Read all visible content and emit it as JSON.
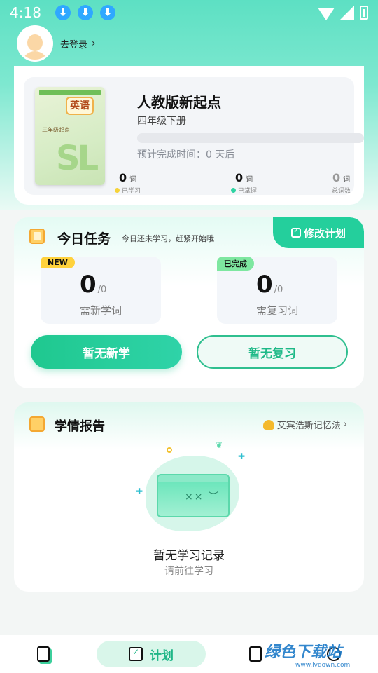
{
  "status_bar": {
    "time": "4:18"
  },
  "user": {
    "login_label": "去登录",
    "chevron": "›"
  },
  "book": {
    "cover_badge": "英语",
    "cover_level": "三年级起点",
    "title": "人教版新起点",
    "subtitle": "四年级下册",
    "progress_fraction": 0,
    "eta": "预计完成时间：0 天后",
    "stats": [
      {
        "value": "0",
        "unit": "词",
        "label": "已学习",
        "color": "#f6d33a"
      },
      {
        "value": "0",
        "unit": "词",
        "label": "已掌握",
        "color": "#2fd3a2"
      },
      {
        "value": "0",
        "unit": "词",
        "label": "总词数"
      }
    ]
  },
  "task": {
    "title": "今日任务",
    "hint": "今日还未学习，赶紧开始哦",
    "edit_plan": "修改计划",
    "new_box": {
      "tag": "NEW",
      "value": "0",
      "denominator": "/0",
      "label": "需新学词"
    },
    "review_box": {
      "tag": "已完成",
      "value": "0",
      "denominator": "/0",
      "label": "需复习词"
    },
    "primary_button": "暂无新学",
    "secondary_button": "暂无复习"
  },
  "report": {
    "title": "学情报告",
    "memory_link": "艾宾浩斯记忆法",
    "chevron": "›",
    "empty_title": "暂无学习记录",
    "empty_sub": "请前往学习"
  },
  "tabbar": {
    "plan_label": "计划"
  },
  "watermark": {
    "text": "绿色下载站",
    "url": "www.lvdown.com"
  }
}
